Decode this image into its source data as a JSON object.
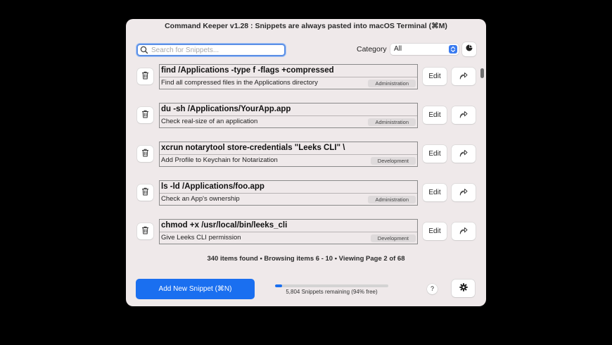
{
  "window": {
    "title": "Command Keeper v1.28 : Snippets are always pasted into macOS Terminal (⌘M)"
  },
  "search": {
    "placeholder": "Search for Snippets...",
    "value": ""
  },
  "category": {
    "label": "Category",
    "selected": "All"
  },
  "snippets": [
    {
      "command": "find /Applications -type f -flags +compressed",
      "description": "Find all compressed files in the Applications directory",
      "category": "Administration"
    },
    {
      "command": "du -sh /Applications/YourApp.app",
      "description": "Check real-size of an application",
      "category": "Administration"
    },
    {
      "command": "xcrun notarytool store-credentials \"Leeks CLI\" \\",
      "description": "Add Profile to Keychain for Notarization",
      "category": "Development"
    },
    {
      "command": "ls -ld /Applications/foo.app",
      "description": "Check an App's ownership",
      "category": "Administration"
    },
    {
      "command": "chmod +x /usr/local/bin/leeks_cli",
      "description": "Give Leeks CLI permission",
      "category": "Development"
    }
  ],
  "row_buttons": {
    "edit_label": "Edit"
  },
  "status": {
    "text": "340 items found • Browsing items 6 - 10 • Viewing Page 2 of 68"
  },
  "footer": {
    "add_label": "Add New Snippet (⌘N)",
    "progress_fraction": 0.06,
    "remaining_text": "5,804 Snippets remaining (94% free)",
    "help_label": "?"
  },
  "colors": {
    "accent": "#1a6ff0",
    "window_bg": "#efe9ea",
    "focus_ring": "#5b8fe6"
  },
  "icons": {
    "search": "magnifier-icon",
    "trash": "trash-icon",
    "share": "share-arrow-icon",
    "pie": "pie-chart-icon",
    "gear": "gear-icon",
    "select_arrows": "chevron-up-down-icon"
  }
}
